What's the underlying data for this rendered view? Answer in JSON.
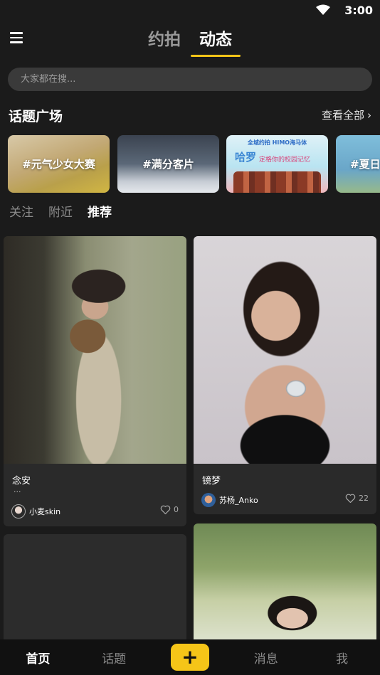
{
  "status_bar": {
    "time": "3:00",
    "wifi_icon": "wifi-icon"
  },
  "header": {
    "menu_icon": "hamburger-menu-icon",
    "tabs": [
      {
        "label": "约拍",
        "active": false
      },
      {
        "label": "动态",
        "active": true
      }
    ],
    "accent_color": "#f5c518"
  },
  "search": {
    "placeholder": "大家都在搜..."
  },
  "topics": {
    "title": "话题广场",
    "view_all": "查看全部",
    "items": [
      {
        "label": "#元气少女大赛"
      },
      {
        "label": "#满分客片"
      },
      {
        "label": "",
        "banner_brand": "全城约拍  HIMO海马体",
        "banner_title": "哈罗",
        "banner_sub": "定格你的校园记忆"
      },
      {
        "label": "#夏日"
      }
    ]
  },
  "feed_tabs": [
    {
      "label": "关注",
      "active": false
    },
    {
      "label": "附近",
      "active": false
    },
    {
      "label": "推荐",
      "active": true
    }
  ],
  "posts": [
    {
      "title": "念安",
      "excerpt": "...",
      "author": "小麦skin",
      "likes": "0"
    },
    {
      "title": "镜梦",
      "author": "苏杨_Anko",
      "likes": "22"
    }
  ],
  "bottom_nav": {
    "items": [
      {
        "label": "首页",
        "active": true
      },
      {
        "label": "话题",
        "active": false
      },
      {
        "label": "+",
        "is_publish": true
      },
      {
        "label": "消息",
        "active": false
      },
      {
        "label": "我",
        "active": false
      }
    ]
  }
}
